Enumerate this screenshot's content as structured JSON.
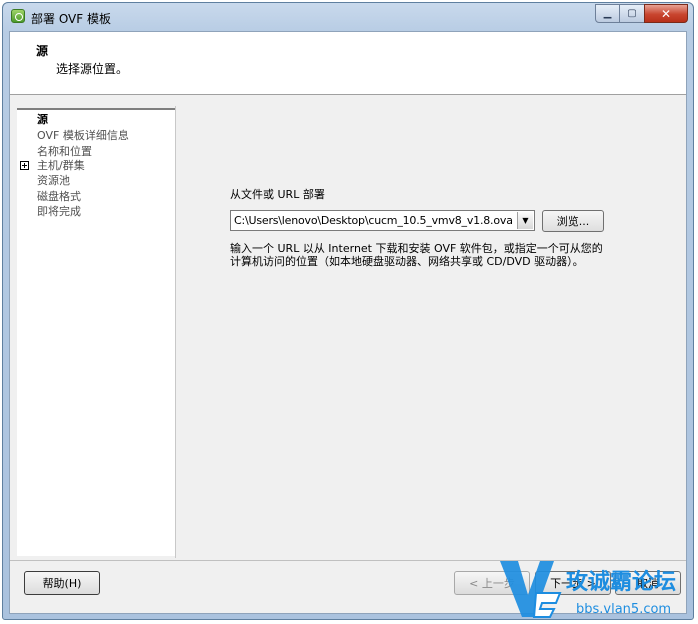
{
  "window": {
    "title": "部署 OVF 模板",
    "controls": {
      "minimize": "▁",
      "maximize": "▢",
      "close": "✕"
    }
  },
  "header": {
    "title": "源",
    "subtitle": "选择源位置。"
  },
  "nav": {
    "items": [
      {
        "label": "源",
        "active": true
      },
      {
        "label": "OVF 模板详细信息"
      },
      {
        "label": "名称和位置"
      },
      {
        "label": "主机/群集",
        "expandable": true
      },
      {
        "label": "资源池"
      },
      {
        "label": "磁盘格式"
      },
      {
        "label": "即将完成"
      }
    ]
  },
  "main": {
    "deploy_label": "从文件或 URL 部署",
    "source_path": "C:\\Users\\lenovo\\Desktop\\cucm_10.5_vmv8_v1.8.ova",
    "dropdown_glyph": "▼",
    "browse_label": "浏览...",
    "description_line1": "输入一个 URL 以从 Internet 下载和安装 OVF 软件包，或指定一个可从您的",
    "description_line2": "计算机访问的位置（如本地硬盘驱动器、网络共享或 CD/DVD 驱动器）。"
  },
  "footer": {
    "help_label": "帮助(H)",
    "back_label": "< 上一步",
    "next_label": "下一步 >",
    "cancel_label": "取消"
  },
  "watermark": {
    "text": "玫诚霸论坛",
    "url": "bbs.vlan5.com"
  },
  "colors": {
    "frame": "#b7cce4",
    "close_button": "#c8452f",
    "watermark_blue": "#1d8de0"
  }
}
